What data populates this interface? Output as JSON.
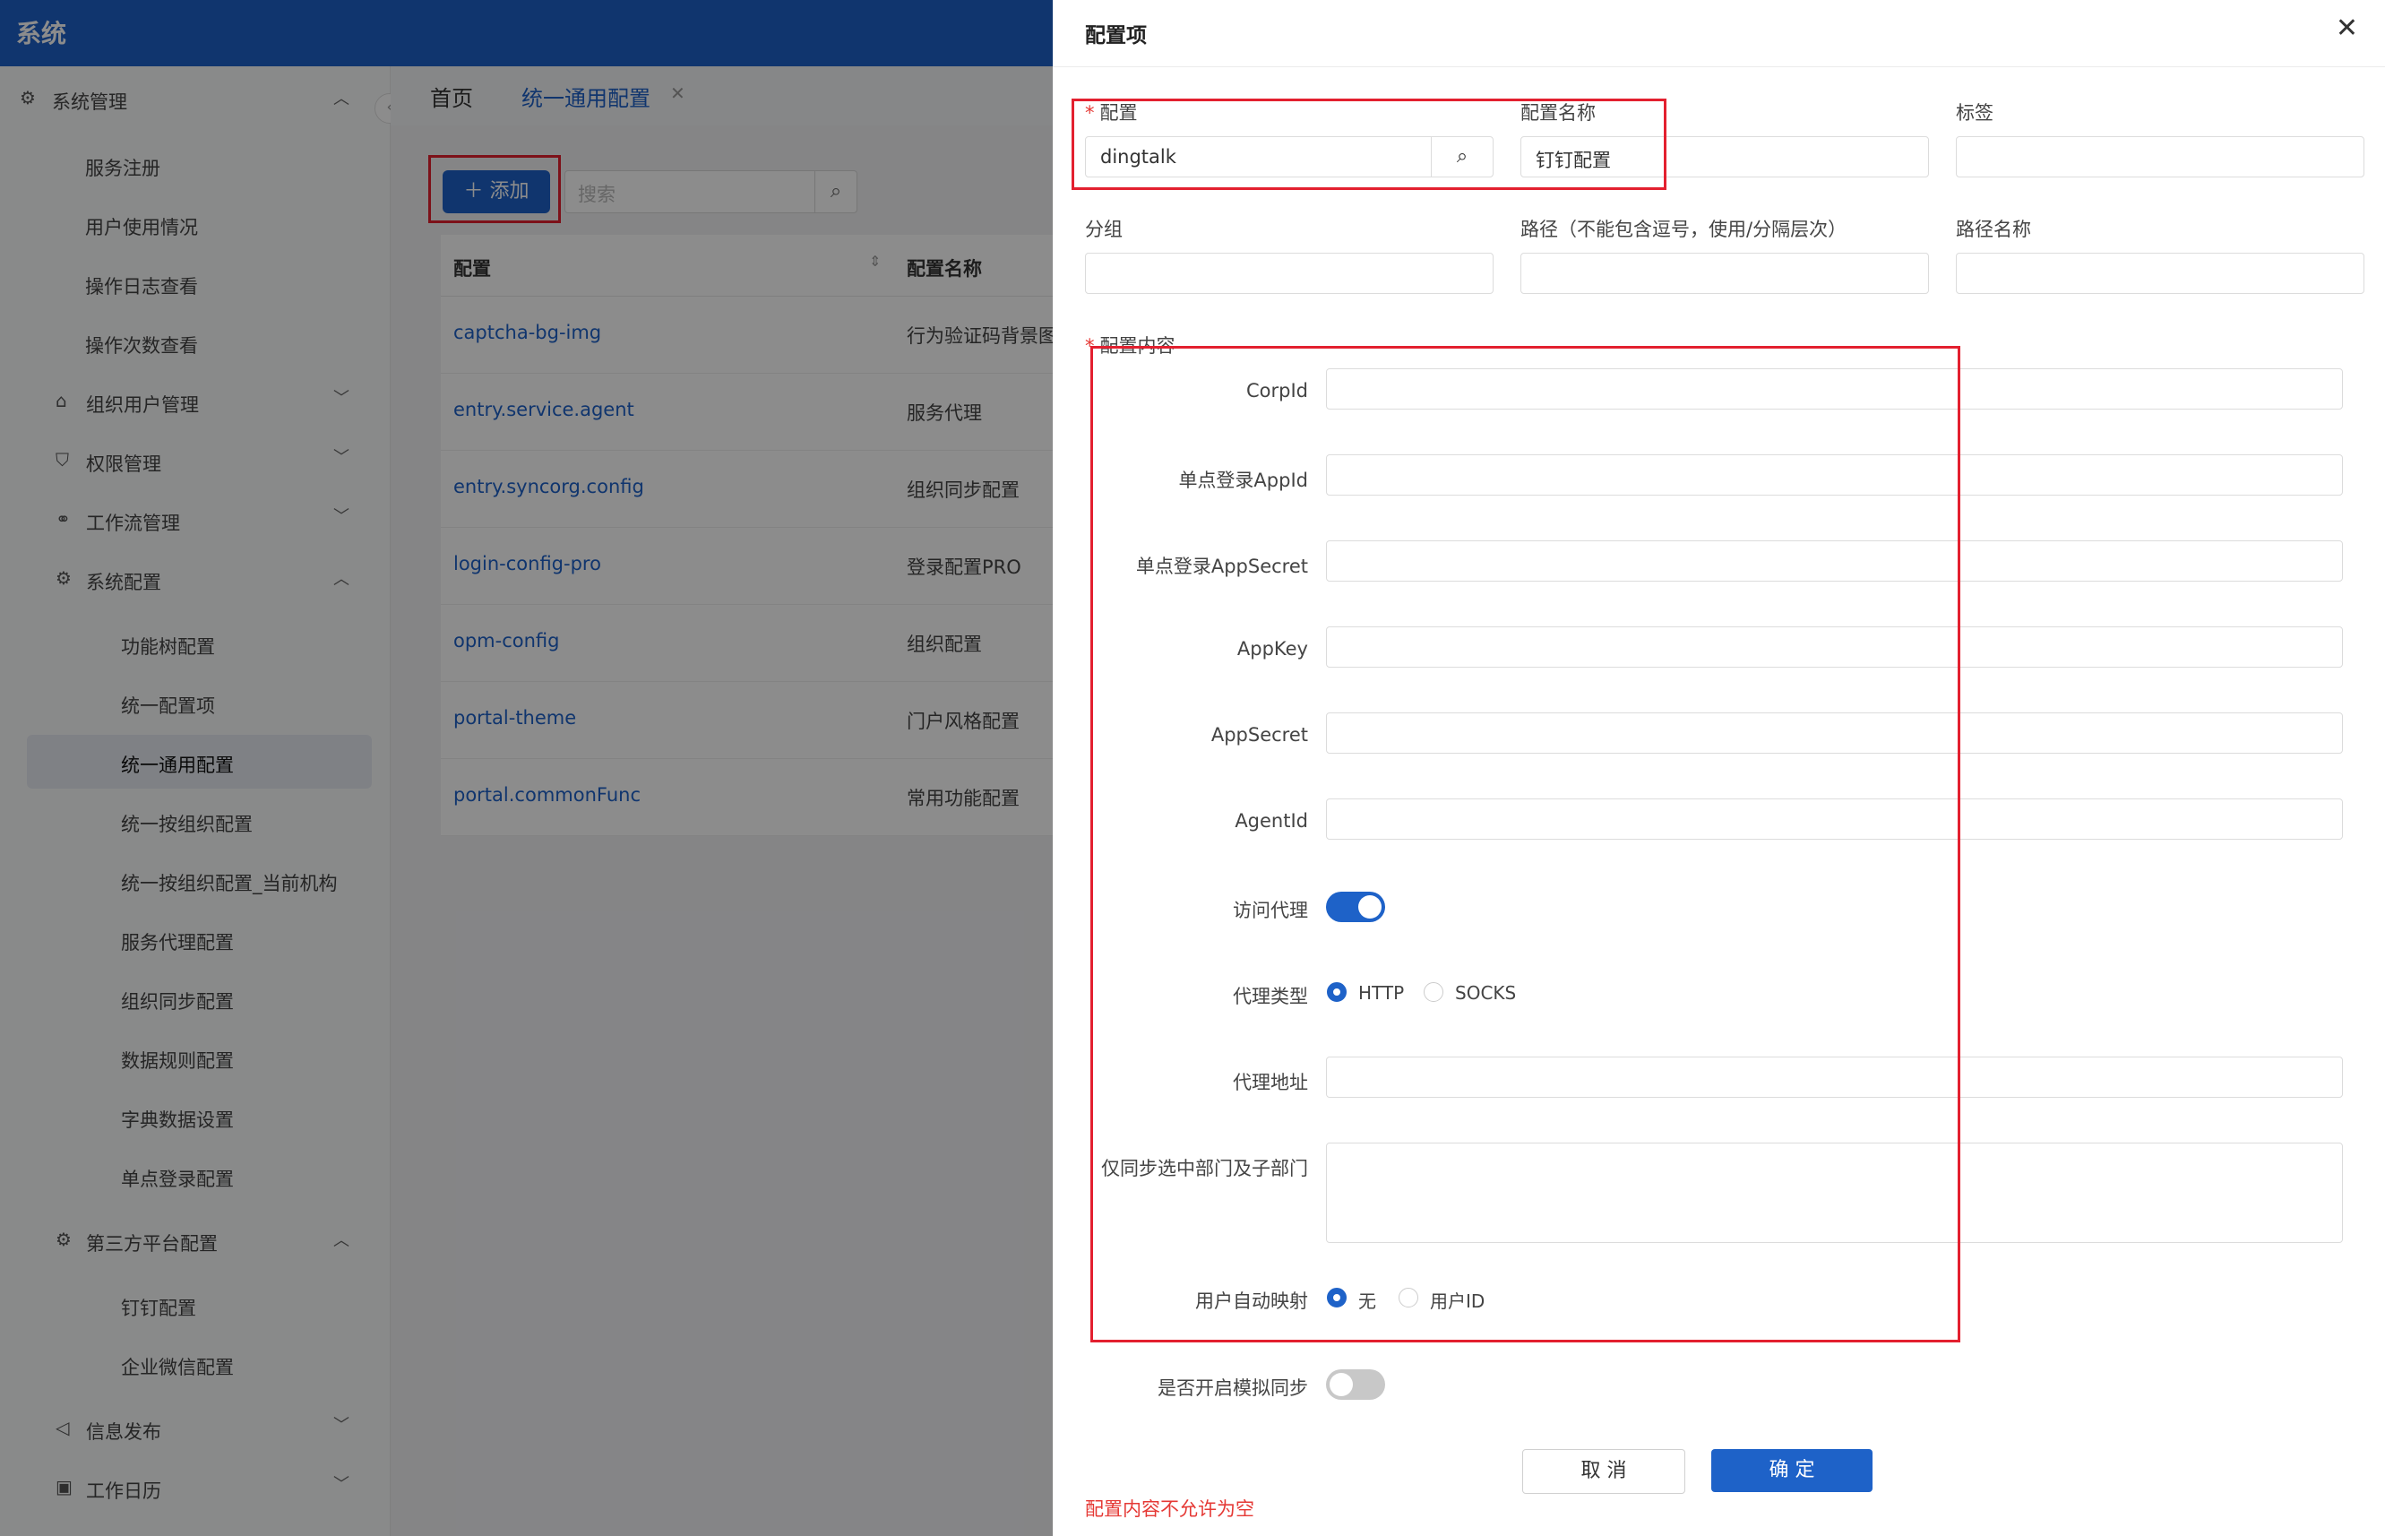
{
  "app": {
    "brand": "系统"
  },
  "sidebar": {
    "groups": [
      {
        "label": "系统管理",
        "icon": "gear-icon",
        "chevron": "⌃"
      },
      {
        "label": "组织用户管理",
        "icon": "bank-icon",
        "chevron": "⌄"
      },
      {
        "label": "权限管理",
        "icon": "user-icon",
        "chevron": "⌄"
      },
      {
        "label": "工作流管理",
        "icon": "flow-icon",
        "chevron": "⌄"
      },
      {
        "label": "系统配置",
        "icon": "gear-icon",
        "chevron": "⌃"
      },
      {
        "label": "第三方平台配置",
        "icon": "gear-icon",
        "chevron": "⌃"
      },
      {
        "label": "信息发布",
        "icon": "speaker-icon",
        "chevron": "⌄"
      },
      {
        "label": "工作日历",
        "icon": "calendar-icon",
        "chevron": "⌄"
      }
    ],
    "items_sys": [
      "服务注册",
      "用户使用情况",
      "操作日志查看",
      "操作次数查看"
    ],
    "items_cfg": [
      "功能树配置",
      "统一配置项",
      "统一通用配置",
      "统一按组织配置",
      "统一按组织配置_当前机构",
      "服务代理配置",
      "组织同步配置",
      "数据规则配置",
      "字典数据设置",
      "单点登录配置"
    ],
    "items_third": [
      "钉钉配置",
      "企业微信配置"
    ]
  },
  "tabs": {
    "home": "首页",
    "active": "统一通用配置",
    "close": "✕"
  },
  "toolbar": {
    "add_label": "添加",
    "search_placeholder": "搜索"
  },
  "table": {
    "headers": [
      "配置",
      "配置名称"
    ],
    "rows": [
      {
        "key": "captcha-bg-img",
        "name": "行为验证码背景图"
      },
      {
        "key": "entry.service.agent",
        "name": "服务代理"
      },
      {
        "key": "entry.syncorg.config",
        "name": "组织同步配置"
      },
      {
        "key": "login-config-pro",
        "name": "登录配置PRO"
      },
      {
        "key": "opm-config",
        "name": "组织配置"
      },
      {
        "key": "portal-theme",
        "name": "门户风格配置"
      },
      {
        "key": "portal.commonFunc",
        "name": "常用功能配置"
      }
    ]
  },
  "drawer": {
    "title": "配置项",
    "close": "✕",
    "fields": {
      "config_label": "配置",
      "config_value": "dingtalk",
      "name_label": "配置名称",
      "name_value": "钉钉配置",
      "tag_label": "标签",
      "group_label": "分组",
      "path_label": "路径（不能包含逗号，使用/分隔层次）",
      "path_name_label": "路径名称",
      "content_label": "配置内容"
    },
    "content": {
      "corpid": "CorpId",
      "sso_appid": "单点登录AppId",
      "sso_secret": "单点登录AppSecret",
      "appkey": "AppKey",
      "appsecret": "AppSecret",
      "agentid": "AgentId",
      "proxy": "访问代理",
      "proxy_on": true,
      "proxy_type": "代理类型",
      "proxy_type_options": [
        "HTTP",
        "SOCKS"
      ],
      "proxy_addr": "代理地址",
      "sync_selected": "仅同步选中部门及子部门",
      "auto_map": "用户自动映射",
      "auto_map_options": [
        "无",
        "用户ID"
      ]
    },
    "simulate": "是否开启模拟同步",
    "simulate_on": false,
    "cancel": "取 消",
    "ok": "确 定",
    "error": "配置内容不允许为空"
  },
  "colors": {
    "primary": "#1e62c8",
    "error": "#e53935",
    "highlight": "#e3202f"
  }
}
